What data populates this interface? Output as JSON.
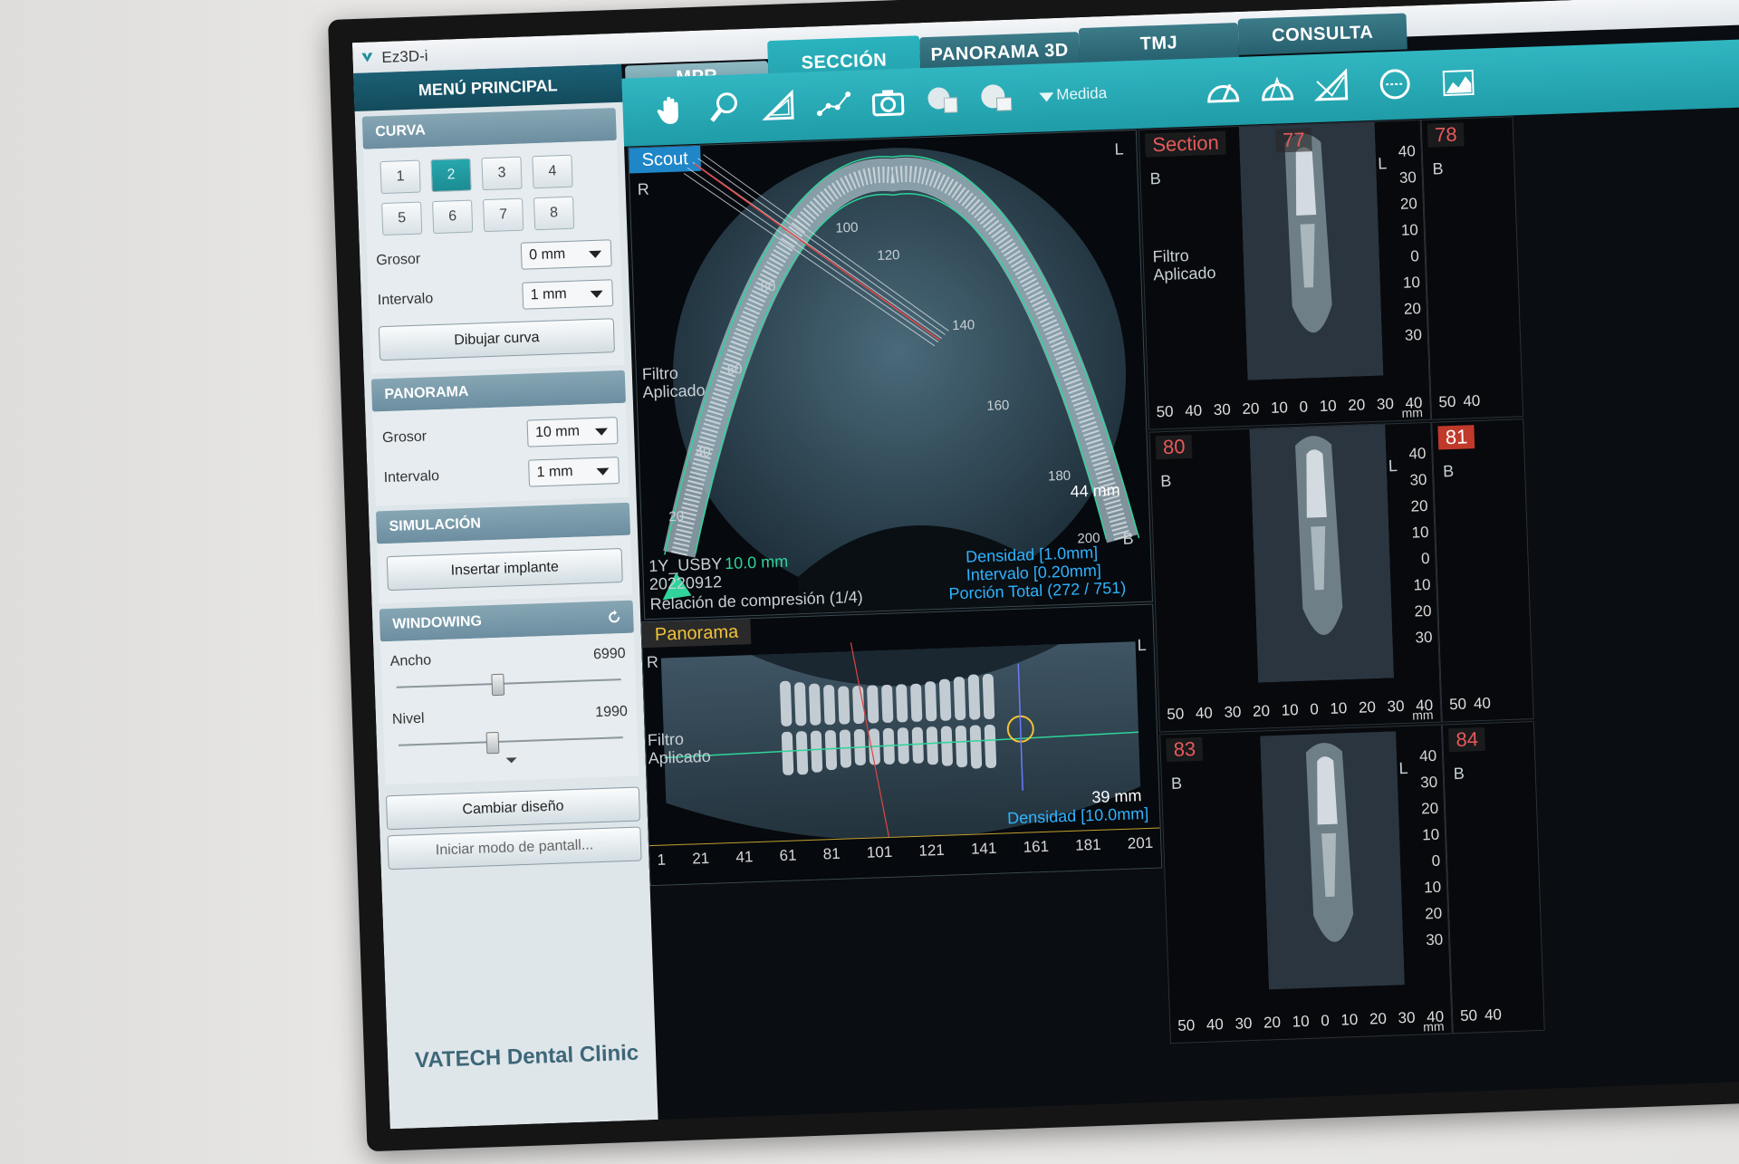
{
  "app": {
    "title": "Ez3D-i"
  },
  "tabs": [
    {
      "label": "MPR"
    },
    {
      "label": "SECCIÓN"
    },
    {
      "label": "PANORAMA 3D"
    },
    {
      "label": "TMJ"
    },
    {
      "label": "CONSULTA"
    }
  ],
  "toolbar": {
    "medida_label": "Medida"
  },
  "sidebar": {
    "menu_title": "MENÚ PRINCIPAL",
    "curva": {
      "title": "CURVA",
      "numbers": [
        "1",
        "2",
        "3",
        "4",
        "5",
        "6",
        "7",
        "8"
      ],
      "selected": "2",
      "grosor_label": "Grosor",
      "grosor_value": "0 mm",
      "intervalo_label": "Intervalo",
      "intervalo_value": "1 mm",
      "draw_button": "Dibujar curva"
    },
    "panorama": {
      "title": "PANORAMA",
      "grosor_label": "Grosor",
      "grosor_value": "10 mm",
      "intervalo_label": "Intervalo",
      "intervalo_value": "1 mm"
    },
    "simulacion": {
      "title": "SIMULACIÓN",
      "button": "Insertar implante"
    },
    "windowing": {
      "title": "WINDOWING",
      "ancho_label": "Ancho",
      "ancho_value": "6990",
      "ancho_level": 0.45,
      "nivel_label": "Nivel",
      "nivel_value": "1990",
      "nivel_level": 0.42
    },
    "change_layout_button": "Cambiar diseño",
    "fullscreen_button": "Iniciar modo de pantall...",
    "brand": "VATECH Dental Clinic"
  },
  "scout": {
    "header": "Scout",
    "orient_r": "R",
    "orient_l": "L",
    "orient_b": "B",
    "filter_line1": "Filtro",
    "filter_line2": "Aplicado",
    "arch_labels": [
      "20",
      "40",
      "60",
      "80",
      "100",
      "120",
      "140",
      "160",
      "180",
      "200"
    ],
    "thickness": "10.0 mm",
    "id_text": "1Y_USBY",
    "date": "20220912",
    "compression": "Relación de compresión (1/4)",
    "size": "44 mm",
    "density": "Densidad [1.0mm]",
    "interval": "Intervalo [0.20mm]",
    "total": "Porción Total (272 / 751)"
  },
  "panorama_view": {
    "header": "Panorama",
    "orient_r": "R",
    "orient_l": "L",
    "filter_line1": "Filtro",
    "filter_line2": "Aplicado",
    "size": "39 mm",
    "density": "Densidad [10.0mm]",
    "ruler": [
      "1",
      "21",
      "41",
      "61",
      "81",
      "101",
      "121",
      "141",
      "161",
      "181",
      "201"
    ]
  },
  "sections": {
    "label": "Section",
    "numbers": [
      "77",
      "78",
      "80",
      "81",
      "83",
      "84"
    ],
    "orient_b": "B",
    "orient_l": "L",
    "filter_line1": "Filtro",
    "filter_line2": "Aplicado",
    "vruler": [
      "40",
      "30",
      "20",
      "10",
      "0",
      "10",
      "20",
      "30"
    ],
    "hruler": [
      "50",
      "40",
      "30",
      "20",
      "10",
      "0",
      "10",
      "20",
      "30",
      "40"
    ],
    "unit": "mm"
  },
  "colors": {
    "accent": "#23a1ad",
    "header_blue": "#1f86c8",
    "section_red": "#e65a5a"
  }
}
